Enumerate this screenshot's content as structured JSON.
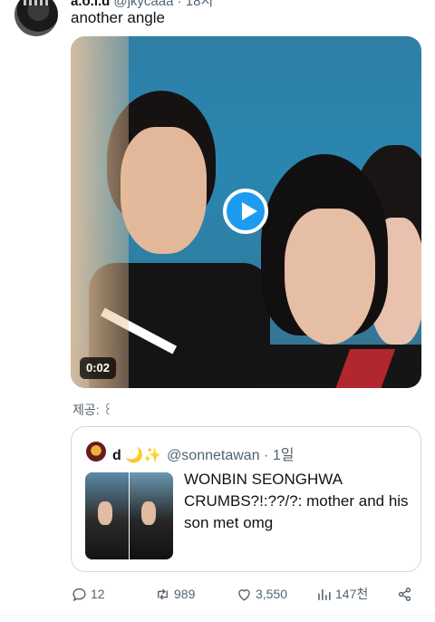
{
  "tweet": {
    "author_name": "a.o.l.d",
    "author_handle": "@jkycaaa · 18시",
    "text": "another angle",
    "media": {
      "duration": "0:02",
      "provided_by": "제공: ꒰"
    },
    "quote": {
      "author_name": "d 🌙✨",
      "author_handle": "@sonnetawan · 1일",
      "text": "WONBIN SEONGHWA CRUMBS?!:??/?: mother and his son met omg"
    },
    "actions": {
      "reply_count": "12",
      "repost_count": "989",
      "like_count": "3,550",
      "view_count": "147천"
    }
  },
  "icons": {
    "reply": "reply-icon",
    "repost": "repost-icon",
    "like": "heart-icon",
    "views": "views-icon",
    "share": "share-icon",
    "play": "play-icon"
  },
  "colors": {
    "accent": "#1d9bf0",
    "secondary_text": "#536471",
    "border": "#cfd9de"
  }
}
